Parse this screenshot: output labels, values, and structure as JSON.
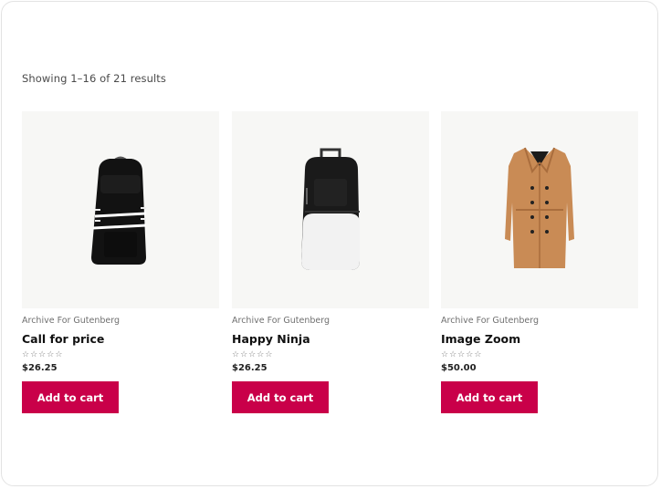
{
  "shop": {
    "result_count": "Showing 1–16 of 21 results"
  },
  "products": [
    {
      "category": "Archive For Gutenberg",
      "title": "Call for price",
      "rating": 0,
      "rating_max": 5,
      "price": "$26.25",
      "button": "Add to cart",
      "image_icon": "black-backpack-image"
    },
    {
      "category": "Archive For Gutenberg",
      "title": "Happy Ninja",
      "rating": 0,
      "rating_max": 5,
      "price": "$26.25",
      "button": "Add to cart",
      "image_icon": "black-white-backpack-image"
    },
    {
      "category": "Archive For Gutenberg",
      "title": "Image Zoom",
      "rating": 0,
      "rating_max": 5,
      "price": "$50.00",
      "button": "Add to cart",
      "image_icon": "tan-coat-image"
    }
  ],
  "colors": {
    "accent": "#c90049",
    "image_bg": "#f7f7f5"
  }
}
